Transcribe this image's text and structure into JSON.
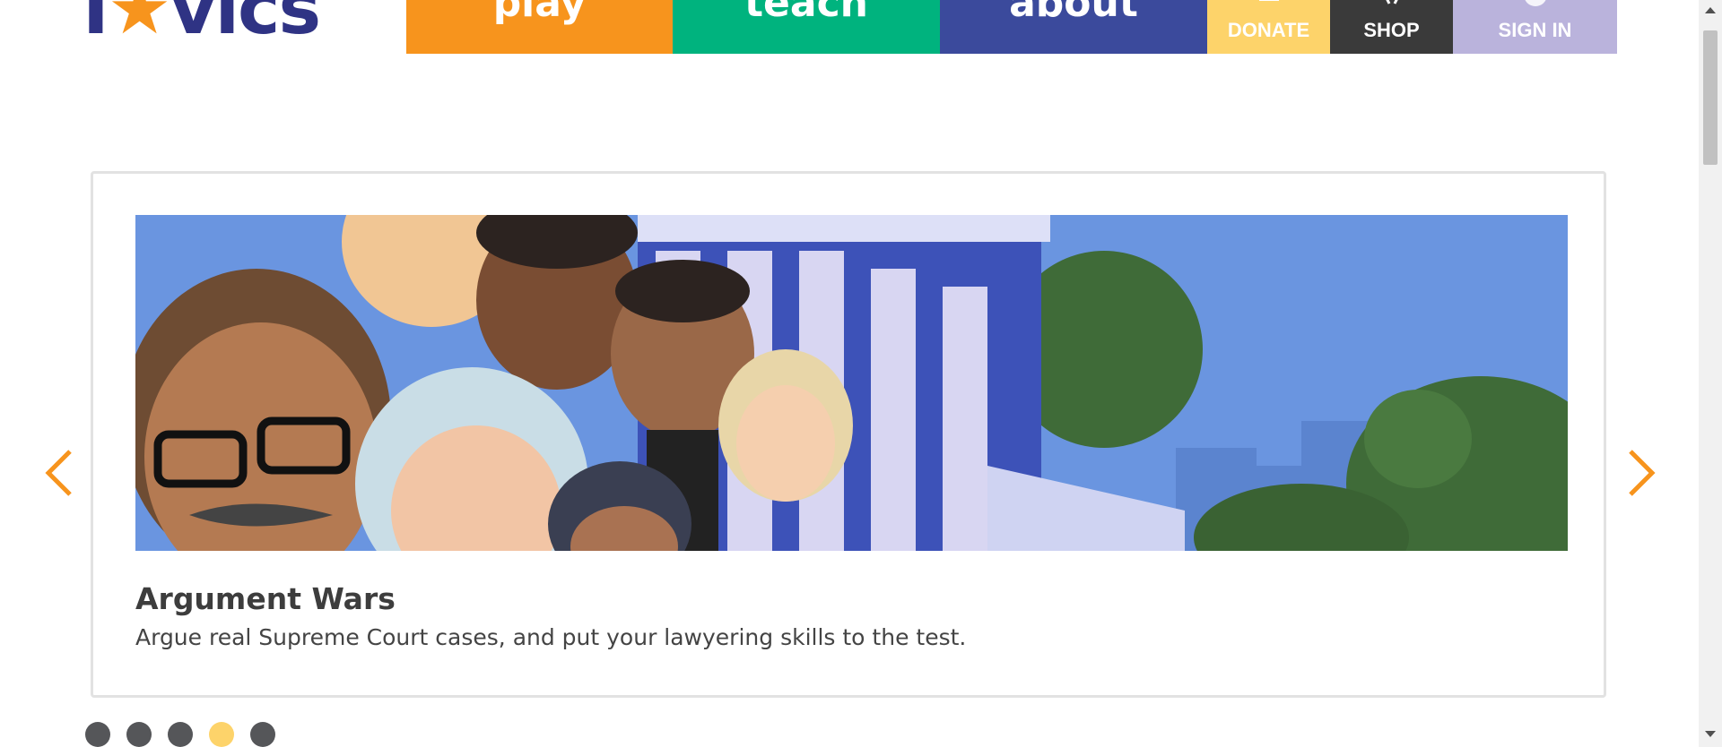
{
  "header": {
    "logo_text_left": "I",
    "logo_star": "★",
    "logo_text_right": "vics",
    "nav_tabs": [
      {
        "label": "play",
        "color": "#f7941d"
      },
      {
        "label": "teach",
        "color": "#00b37e"
      },
      {
        "label": "about",
        "color": "#3b4a9c"
      }
    ],
    "donate_label": "DONATE",
    "shop_label": "SHOP",
    "signin_label": "SIGN IN"
  },
  "carousel": {
    "title": "Argument Wars",
    "description": "Argue real Supreme Court cases, and put your lawyering skills to the test.",
    "dots": 5,
    "active_dot_index": 3,
    "accent_color": "#f7941d",
    "active_dot_color": "#fdd36a"
  },
  "icons": {
    "prev": "chevron-left-icon",
    "next": "chevron-right-icon",
    "donate": "donate-icon",
    "shop": "shop-icon",
    "signin": "user-avatar-icon"
  }
}
